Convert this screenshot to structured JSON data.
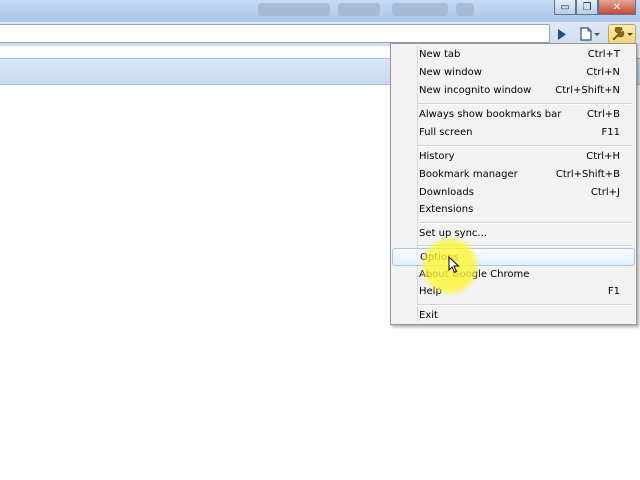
{
  "window": {
    "minimize_glyph": "▭",
    "maximize_glyph": "❐",
    "close_glyph": "✕"
  },
  "toolbar": {
    "omnibox_value": "",
    "icons": [
      "play-icon",
      "page-icon",
      "wrench-icon"
    ]
  },
  "colors": {
    "titlebar": "#a9c6e8",
    "menu_background": "#f2f2f2",
    "menu_highlight_border": "#a8c6ea",
    "cursor_halo": "#fff53c",
    "wrench_button": "#f2d478"
  },
  "menu": {
    "items": [
      {
        "label": "New tab",
        "shortcut": "Ctrl+T"
      },
      {
        "label": "New window",
        "shortcut": "Ctrl+N"
      },
      {
        "label": "New incognito window",
        "shortcut": "Ctrl+Shift+N"
      },
      {
        "label": "Always show bookmarks bar",
        "shortcut": "Ctrl+B"
      },
      {
        "label": "Full screen",
        "shortcut": "F11"
      },
      {
        "label": "History",
        "shortcut": "Ctrl+H"
      },
      {
        "label": "Bookmark manager",
        "shortcut": "Ctrl+Shift+B"
      },
      {
        "label": "Downloads",
        "shortcut": "Ctrl+J"
      },
      {
        "label": "Extensions",
        "shortcut": ""
      },
      {
        "label": "Set up sync...",
        "shortcut": ""
      },
      {
        "label": "Options",
        "shortcut": ""
      },
      {
        "label": "About Google Chrome",
        "shortcut": ""
      },
      {
        "label": "Help",
        "shortcut": "F1"
      },
      {
        "label": "Exit",
        "shortcut": ""
      }
    ],
    "highlighted_item": "Options"
  }
}
